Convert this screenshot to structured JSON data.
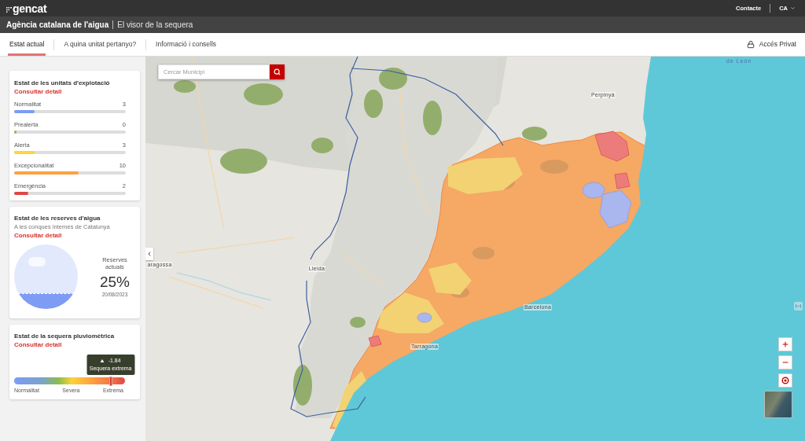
{
  "header": {
    "logo": "gencat",
    "link": "Contacte",
    "language": "CA"
  },
  "title_bar": {
    "agency": "Agència catalana de l'aigua",
    "app": "El visor de la sequera"
  },
  "nav": {
    "tabs": [
      {
        "label": "Estat actual",
        "selected": true
      },
      {
        "label": "A quina unitat pertanyo?",
        "selected": false
      },
      {
        "label": "Informació i consells",
        "selected": false
      }
    ],
    "private_access": "Accés Privat"
  },
  "units_card": {
    "title": "Estat de les unitats d'explotació",
    "link": "Consultar detall",
    "rows": [
      {
        "label": "Normalitat",
        "count": "3",
        "level": 0.18,
        "color": "#7b9cf5"
      },
      {
        "label": "Prealerta",
        "count": "0",
        "level": 0.02,
        "color": "#8cbf4f"
      },
      {
        "label": "Alerta",
        "count": "3",
        "level": 0.18,
        "color": "#fdd43a"
      },
      {
        "label": "Excepcionalitat",
        "count": "10",
        "level": 0.58,
        "color": "#ffa040"
      },
      {
        "label": "Emergència",
        "count": "2",
        "level": 0.13,
        "color": "#e04646"
      }
    ]
  },
  "reserves_card": {
    "title": "Estat de les reserves d'aigua",
    "subtitle": "A les conques internes de Catalunya",
    "link": "Consultar detall",
    "level": 0.25,
    "caption": "Reserves actuals",
    "value": "25%",
    "date": "20/08/2023"
  },
  "drought_card": {
    "title": "Estat de la sequera pluviomètrica",
    "link": "Consultar detall",
    "level": 0.87,
    "tooltip": {
      "value": "-1.84",
      "label": "Sequera extrema"
    },
    "scale_labels": [
      "Normalitat",
      "Severa",
      "Extrema"
    ]
  },
  "map": {
    "search": {
      "placeholder": "Cercar Municipi"
    },
    "labels": [
      {
        "text": "de León",
        "kind": "sea"
      },
      {
        "text": "Perpinyà",
        "kind": "city"
      },
      {
        "text": "aragossa",
        "kind": "city"
      },
      {
        "text": "Lleida",
        "kind": "city"
      },
      {
        "text": "Barcelona",
        "kind": "city"
      },
      {
        "text": "Tarragona",
        "kind": "city"
      }
    ]
  }
}
